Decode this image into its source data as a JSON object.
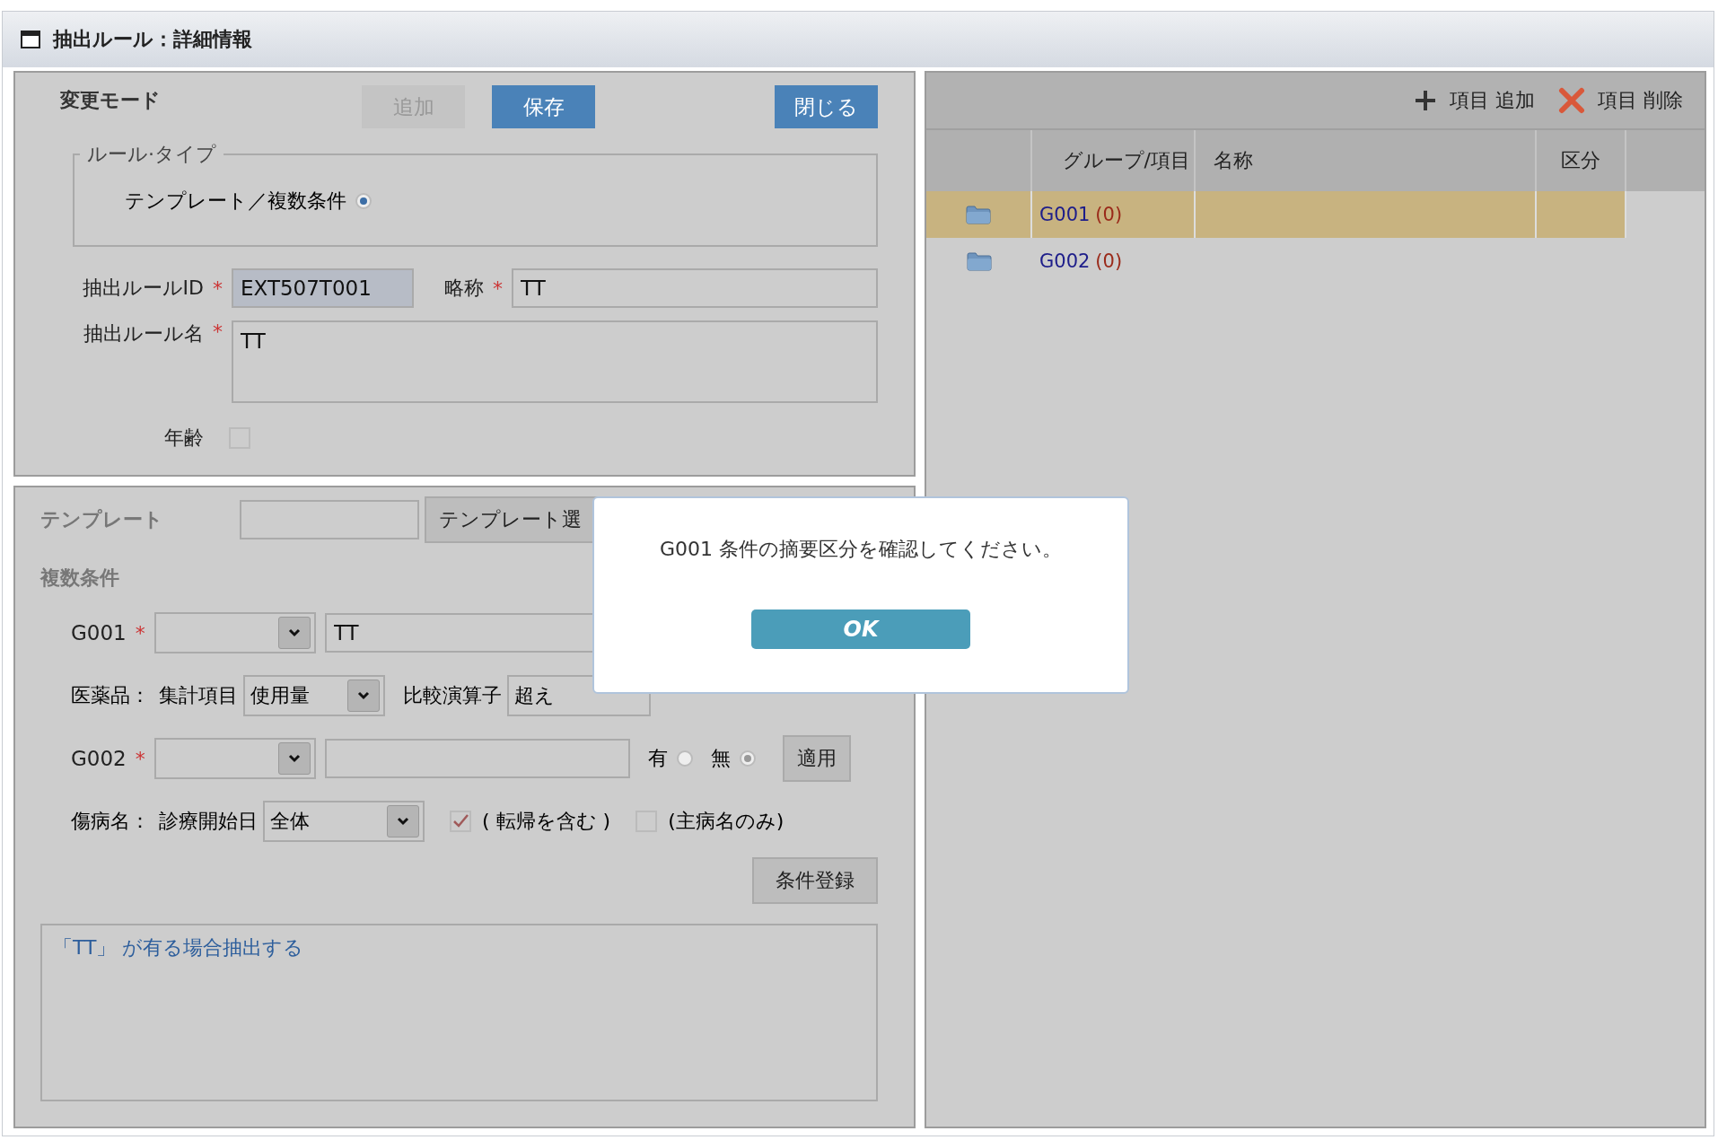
{
  "window": {
    "title": "抽出ルール：詳細情報"
  },
  "mode_label": "変更モード",
  "buttons": [
    {
      "label": "追加",
      "disabled": true
    },
    {
      "label": "保存",
      "disabled": false
    },
    {
      "label": "閉じる",
      "disabled": false
    }
  ],
  "rule_type": {
    "legend": "ルール·タイプ",
    "options": [
      {
        "label": "テンプレート／複数条件",
        "selected": true
      }
    ]
  },
  "rule_id": {
    "label": "抽出ルールID",
    "mark": "*",
    "value": "EXT507T001",
    "readonly": true
  },
  "short_name": {
    "label": "略称",
    "mark": "*",
    "value": "TT",
    "readonly": false
  },
  "rule_name": {
    "label": "抽出ルール名",
    "mark": "*",
    "value": "TT"
  },
  "age": {
    "label": "年齢",
    "checked": false
  },
  "template": {
    "label": "テンプレート",
    "button": "テンプレート選"
  },
  "multi_label": "複数条件",
  "conditions": [
    {
      "kind": "group",
      "label": "G001",
      "mark": "*",
      "text": "TT"
    },
    {
      "kind": "drug",
      "prefix": "医薬品：",
      "label": "集計項目",
      "select": "使用量",
      "op_label": "比較演算子",
      "op_select": "超え"
    },
    {
      "kind": "group",
      "label": "G002",
      "mark": "*",
      "radios": [
        {
          "label": "有",
          "selected": false
        },
        {
          "label": "無",
          "selected": true
        }
      ],
      "apply": "適用"
    },
    {
      "kind": "disease",
      "prefix": "傷病名：",
      "label": "診療開始日",
      "select": "全体",
      "checks": [
        {
          "label": "( 転帰を含む )",
          "checked": true
        },
        {
          "label": "(主病名のみ)",
          "checked": false
        }
      ]
    }
  ],
  "register_button": "条件登録",
  "summary": "「TT」 が有る場合抽出する",
  "toolbar": [
    {
      "kind": "add",
      "label": "項目 追加"
    },
    {
      "kind": "delete",
      "label": "項目 削除"
    }
  ],
  "table": {
    "columns": [
      "グループ/項目",
      "名称",
      "区分"
    ],
    "rows": [
      {
        "group": "G001",
        "count": "(0)",
        "selected": true
      },
      {
        "group": "G002",
        "count": "(0)",
        "selected": false
      }
    ]
  },
  "dialog": {
    "message": "G001 条件の摘要区分を確認してください。",
    "ok": "OK"
  }
}
